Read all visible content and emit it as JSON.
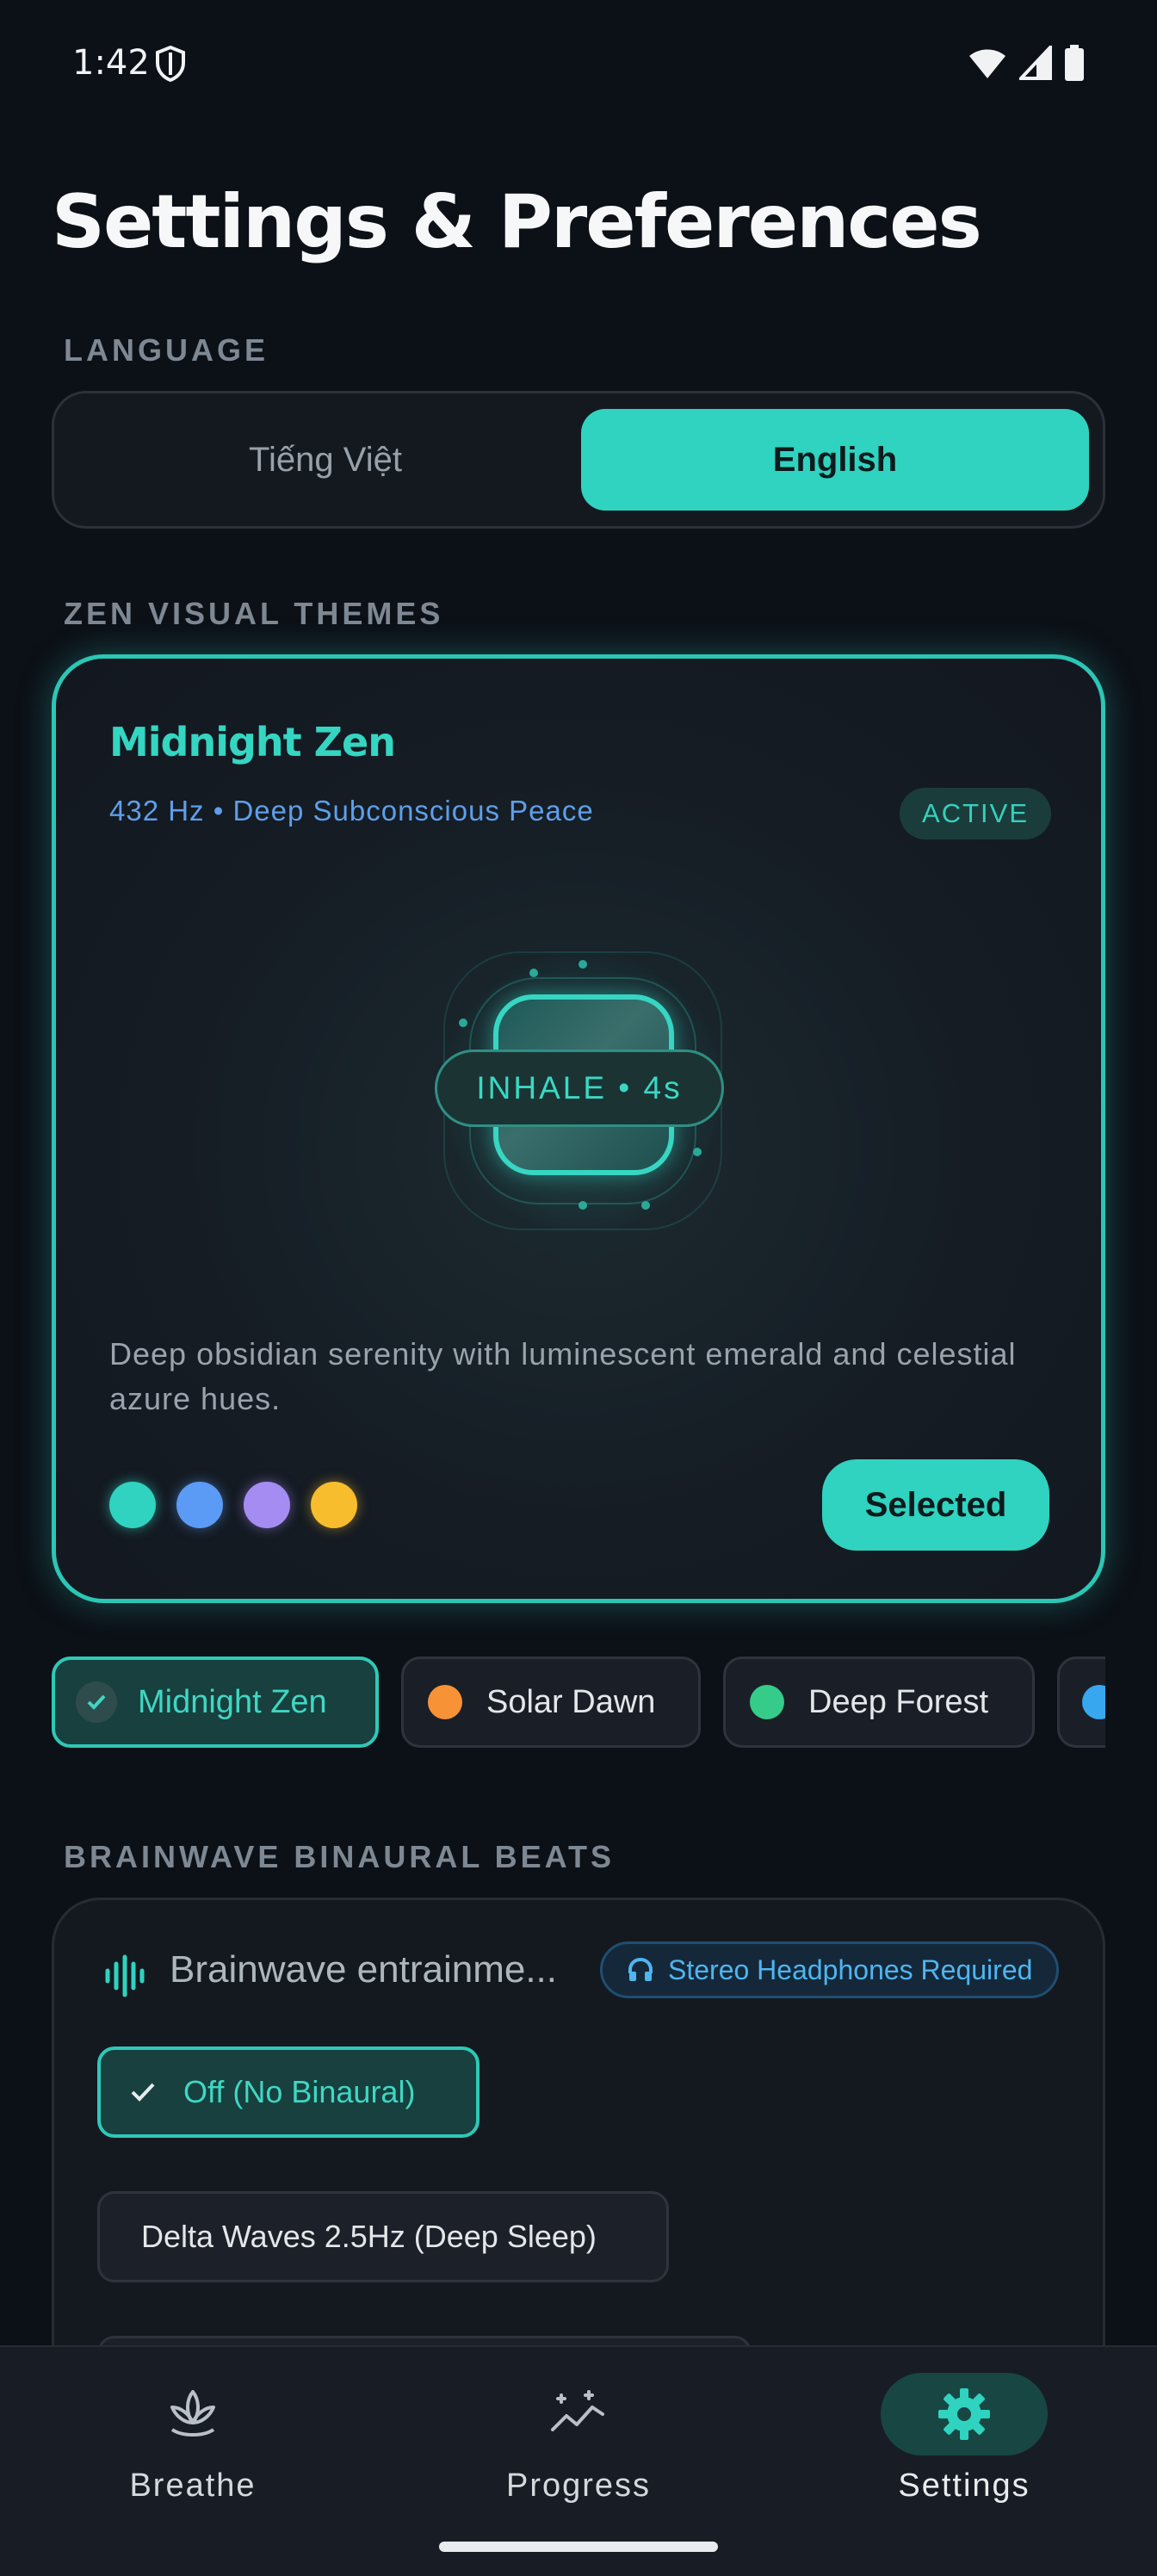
{
  "status_bar": {
    "time": "1:42"
  },
  "page": {
    "title": "Settings & Preferences"
  },
  "language": {
    "section_label": "LANGUAGE",
    "options": [
      "Tiếng Việt",
      "English"
    ],
    "selected": "English"
  },
  "themes": {
    "section_label": "ZEN VISUAL THEMES",
    "featured": {
      "name": "Midnight Zen",
      "subtitle": "432 Hz • Deep Subconscious Peace",
      "badge": "ACTIVE",
      "breath_label": "INHALE • 4s",
      "description": "Deep obsidian serenity with luminescent emerald and celestial azure hues.",
      "swatches": [
        "#2fd3c0",
        "#5b9bf5",
        "#a58cf3",
        "#f8bd2d"
      ],
      "button_label": "Selected"
    },
    "chips": [
      {
        "label": "Midnight Zen",
        "color": "#2fd3c0",
        "active": true
      },
      {
        "label": "Solar Dawn",
        "color": "#f79236",
        "active": false
      },
      {
        "label": "Deep Forest",
        "color": "#35cc8a",
        "active": false
      },
      {
        "label": "",
        "color": "#37a8f0",
        "active": false
      }
    ]
  },
  "binaural": {
    "section_label": "BRAINWAVE BINAURAL BEATS",
    "title": "Brainwave entrainme...",
    "headphones_badge": "Stereo Headphones Required",
    "options": [
      "Off (No Binaural)",
      "Delta Waves 2.5Hz (Deep Sleep)"
    ]
  },
  "nav": {
    "items": [
      "Breathe",
      "Progress",
      "Settings"
    ],
    "active": "Settings"
  },
  "colors": {
    "accent": "#2fd3c0",
    "background": "#0c1017",
    "info": "#4fb5f0"
  }
}
